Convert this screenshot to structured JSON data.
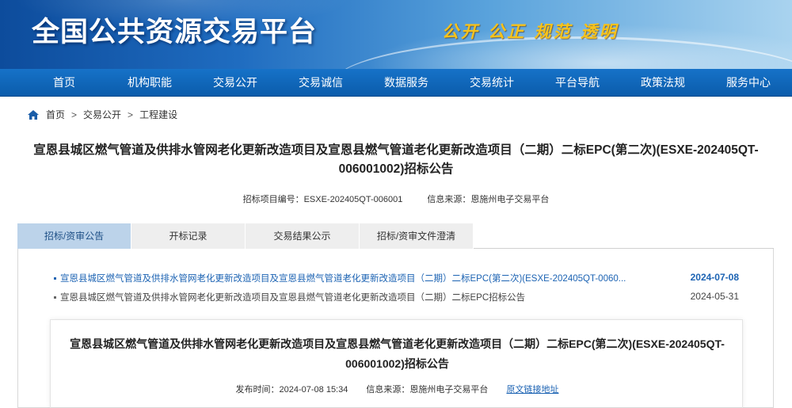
{
  "header": {
    "site_title": "全国公共资源交易平台",
    "slogan": "公开 公正 规范 透明"
  },
  "nav": {
    "items": [
      "首页",
      "机构职能",
      "交易公开",
      "交易诚信",
      "数据服务",
      "交易统计",
      "平台导航",
      "政策法规",
      "服务中心"
    ]
  },
  "breadcrumb": {
    "icon": "home-icon",
    "items": [
      "首页",
      "交易公开",
      "工程建设"
    ],
    "separator": ">"
  },
  "page": {
    "title": "宣恩县城区燃气管道及供排水管网老化更新改造项目及宣恩县燃气管道老化更新改造项目（二期）二标EPC(第二次)(ESXE-202405QT-006001002)招标公告",
    "project_code": "招标项目编号：ESXE-202405QT-006001",
    "source": "信息来源：恩施州电子交易平台"
  },
  "tabs": [
    "招标/资审公告",
    "开标记录",
    "交易结果公示",
    "招标/资审文件澄清"
  ],
  "documents": [
    {
      "title": "宣恩县城区燃气管道及供排水管网老化更新改造项目及宣恩县燃气管道老化更新改造项目（二期）二标EPC(第二次)(ESXE-202405QT-0060...",
      "date": "2024-07-08"
    },
    {
      "title": "宣恩县城区燃气管道及供排水管网老化更新改造项目及宣恩县燃气管道老化更新改造项目（二期）二标EPC招标公告",
      "date": "2024-05-31"
    }
  ],
  "detail": {
    "title": "宣恩县城区燃气管道及供排水管网老化更新改造项目及宣恩县燃气管道老化更新改造项目（二期）二标EPC(第二次)(ESXE-202405QT-006001002)招标公告",
    "publish_time": "发布时间：2024-07-08 15:34",
    "source": "信息来源：恩施州电子交易平台",
    "original_link": "原文链接地址"
  },
  "colors": {
    "nav_blue": "#0b5cab",
    "active_tab": "#bcd3ea",
    "link_blue": "#1c63b3",
    "slogan_gold": "#f7c21a"
  }
}
